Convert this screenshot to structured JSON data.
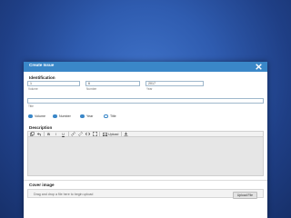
{
  "modal": {
    "title": "Create Issue"
  },
  "identification": {
    "heading": "Identification",
    "volume": {
      "value": "1",
      "label": "Volume"
    },
    "number": {
      "value": "6",
      "label": "Number"
    },
    "year": {
      "value": "2017",
      "label": "Year"
    },
    "title_field": {
      "value": "",
      "label": "Title"
    }
  },
  "display_options": [
    {
      "label": "Volume",
      "checked": true
    },
    {
      "label": "Number",
      "checked": true
    },
    {
      "label": "Year",
      "checked": true
    },
    {
      "label": "Title",
      "checked": false
    }
  ],
  "description": {
    "heading": "Description",
    "toolbar": {
      "upload_label": "Upload"
    }
  },
  "cover_image": {
    "heading": "Cover image",
    "drop_text": "Drag and drop a file here to begin upload",
    "upload_button": "Upload File"
  },
  "colors": {
    "header": "#3a87c8",
    "background": "#2f5cb0"
  }
}
